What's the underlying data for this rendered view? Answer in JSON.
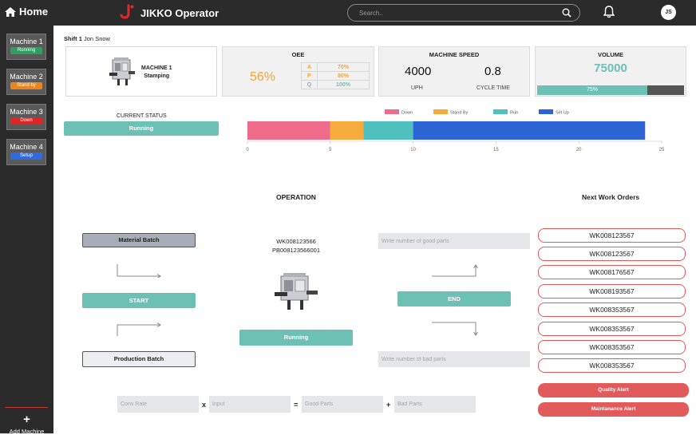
{
  "header": {
    "home_label": "Home",
    "app_title": "JIKKO Operator",
    "search_placeholder": "Search..",
    "user_initials": "JS"
  },
  "sidebar": {
    "machines": [
      {
        "name": "Machine 1",
        "status": "Running",
        "status_color": "#2f9e5e"
      },
      {
        "name": "Machine 2",
        "status": "Stand by",
        "status_color": "#e8861e"
      },
      {
        "name": "Machine 3",
        "status": "Down",
        "status_color": "#e02424"
      },
      {
        "name": "Machine 4",
        "status": "Setup",
        "status_color": "#2f6bde"
      }
    ],
    "add_label": "Add Machine"
  },
  "shift": {
    "label": "Shift 1",
    "operator": "Jon Snow"
  },
  "machine_card": {
    "name": "MACHINE 1",
    "process": "Stamping"
  },
  "oee": {
    "title": "OEE",
    "value": "56%",
    "rows": [
      {
        "key": "A",
        "value": "70%",
        "color": "#f0a63a"
      },
      {
        "key": "P",
        "value": "80%",
        "color": "#f0a63a"
      },
      {
        "key": "Q",
        "value": "100%",
        "color": "#6cc1b4"
      }
    ]
  },
  "machine_speed": {
    "title": "MACHINE SPEED",
    "uph_value": "4000",
    "uph_label": "UPH",
    "cycle_value": "0.8",
    "cycle_label": "CYCLE TIME"
  },
  "volume": {
    "title": "VOLUME",
    "value": "75000",
    "progress_label": "75%",
    "progress": 0.75
  },
  "current_status": {
    "label": "CURRENT STATUS",
    "value": "Running"
  },
  "chart_data": {
    "type": "bar",
    "orientation": "horizontal",
    "stacked": true,
    "series": [
      {
        "name": "Down",
        "values": [
          5
        ],
        "color": "#ef6b8a"
      },
      {
        "name": "Stand By",
        "values": [
          2
        ],
        "color": "#f6ab3c"
      },
      {
        "name": "Run",
        "values": [
          3
        ],
        "color": "#4fc0bd"
      },
      {
        "name": "Set Up",
        "values": [
          14
        ],
        "color": "#2c64d6"
      }
    ],
    "xlim": [
      0,
      25
    ],
    "xticks": [
      0,
      5,
      10,
      15,
      20,
      25
    ],
    "legend": "top",
    "grid": false
  },
  "operation": {
    "title": "OPERATION",
    "material_batch": "Material Batch",
    "start": "START",
    "production_batch": "Production Batch",
    "work_order": "WK008123566",
    "batch_code": "PB008123566001",
    "status": "Running",
    "end": "END",
    "good_parts_placeholder": "Write number of good parts",
    "bad_parts_placeholder": "Write number of bad parts"
  },
  "calc": {
    "conv_rate_placeholder": "Conv Rate",
    "times": "x",
    "input_placeholder": "Input",
    "equals": "=",
    "good_parts_placeholder": "Good Parts",
    "plus": "+",
    "bad_parts_placeholder": "Bad Parts"
  },
  "next_orders": {
    "title": "Next Work Orders",
    "items": [
      "WK008123567",
      "WK008123567",
      "WK008176567",
      "WK008193567",
      "WK008353567",
      "WK008353567",
      "WK008353567",
      "WK008353567"
    ],
    "quality_alert": "Quality Alert",
    "maintenance_alert": "Maintanance Alert"
  }
}
